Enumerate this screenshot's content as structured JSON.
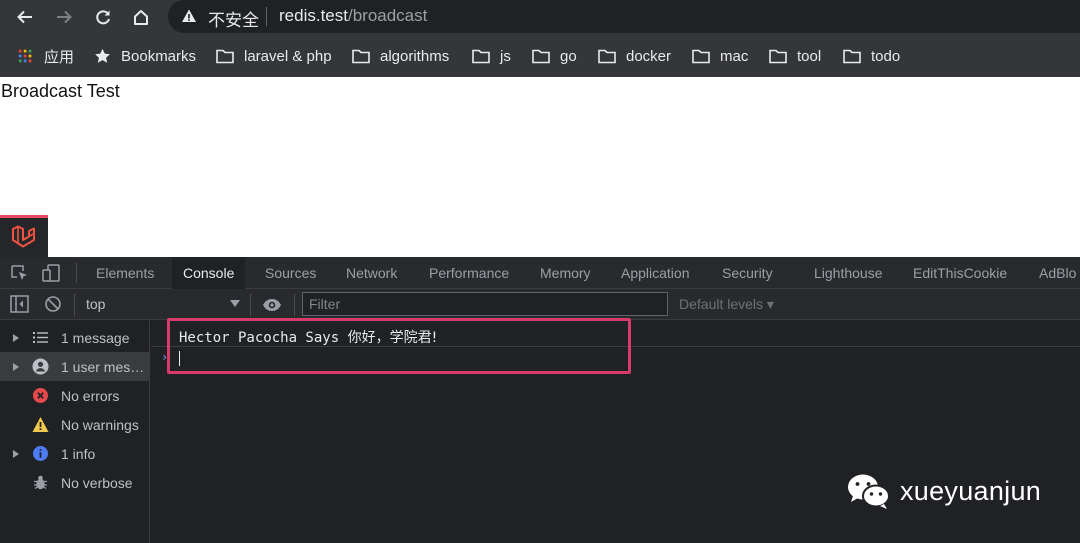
{
  "address_bar": {
    "security_label": "不安全",
    "url_host": "redis.test",
    "url_path": "/broadcast"
  },
  "bookmarks_bar": {
    "items": [
      {
        "label": "应用",
        "icon": "apps-grid-icon"
      },
      {
        "label": "Bookmarks",
        "icon": "star-icon"
      },
      {
        "label": "laravel & php",
        "icon": "folder-icon"
      },
      {
        "label": "algorithms",
        "icon": "folder-icon"
      },
      {
        "label": "js",
        "icon": "folder-icon"
      },
      {
        "label": "go",
        "icon": "folder-icon"
      },
      {
        "label": "docker",
        "icon": "folder-icon"
      },
      {
        "label": "mac",
        "icon": "folder-icon"
      },
      {
        "label": "tool",
        "icon": "folder-icon"
      },
      {
        "label": "todo",
        "icon": "folder-icon"
      }
    ]
  },
  "page": {
    "heading": "Broadcast Test"
  },
  "devtools": {
    "tabs": [
      "Elements",
      "Console",
      "Sources",
      "Network",
      "Performance",
      "Memory",
      "Application",
      "Security",
      "Lighthouse",
      "EditThisCookie",
      "AdBlo"
    ],
    "active_tab": "Console",
    "context": "top",
    "filter_placeholder": "Filter",
    "levels_label": "Default levels ▾",
    "sidebar": [
      {
        "label": "1 message",
        "icon": "list-icon"
      },
      {
        "label": "1 user mes…",
        "icon": "user-icon"
      },
      {
        "label": "No errors",
        "icon": "error-icon"
      },
      {
        "label": "No warnings",
        "icon": "warning-icon"
      },
      {
        "label": "1 info",
        "icon": "info-icon"
      },
      {
        "label": "No verbose",
        "icon": "bug-icon"
      }
    ],
    "console_output": {
      "prefix": "Hector Pacocha Says ",
      "message": "你好，学院君!"
    }
  },
  "watermark": {
    "text": "xueyuanjun"
  },
  "colors": {
    "highlight_border": "#d83a69",
    "laravel_red": "#f05340",
    "error_red": "#e5484d",
    "warning_yellow": "#f2c94c",
    "info_blue": "#4e7cf6"
  }
}
